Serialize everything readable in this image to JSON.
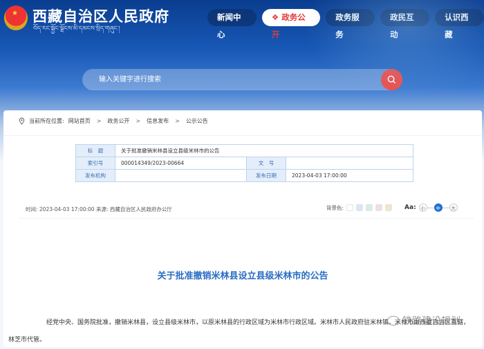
{
  "header": {
    "title": "西藏自治区人民政府",
    "subtitle": "བོད་རང་སྐྱོང་ལྗོངས་མི་དམངས་སྲིད་གཞུང་།",
    "nav": [
      {
        "label": "新闻中心"
      },
      {
        "label": "政务公开",
        "active": true
      },
      {
        "label": "政务服务"
      },
      {
        "label": "政民互动"
      },
      {
        "label": "认识西藏"
      }
    ]
  },
  "search": {
    "placeholder": "输入关键字进行搜索"
  },
  "breadcrumb": {
    "prefix": "当前所在位置:",
    "items": [
      "网站首页",
      "政务公开",
      "信息发布",
      "公示公告"
    ],
    "sep": ">"
  },
  "meta": {
    "title_label": "标　题",
    "title": "关于批准撤销米林县设立县级米林市的公告",
    "index_label": "索引号",
    "index": "000014349/2023-00664",
    "docno_label": "文　号",
    "docno": "",
    "org_label": "发布机构",
    "org": "",
    "date_label": "发布日期",
    "date": "2023-04-03 17:00:00"
  },
  "info": {
    "text": "时间:  2023-04-03 17:00:00 来源:  西藏自治区人民政府办公厅",
    "bg_label": "背景色:",
    "bg_colors": [
      "#ffffff",
      "#dbe6f5",
      "#d6efe3",
      "#f0dcef",
      "#f3e6c8"
    ],
    "aa": "Aa:",
    "sizes": [
      "小",
      "中",
      "大"
    ]
  },
  "article": {
    "title": "关于批准撤销米林县设立县级米林市的公告",
    "body": "经党中央、国务院批准，撤销米林县，设立县级米林市，以原米林县的行政区域为米林市行政区域。米林市人民政府驻米林镇。米林市由西藏自治区直辖，林芝市代管。"
  },
  "watermark": "铁路建设规划"
}
